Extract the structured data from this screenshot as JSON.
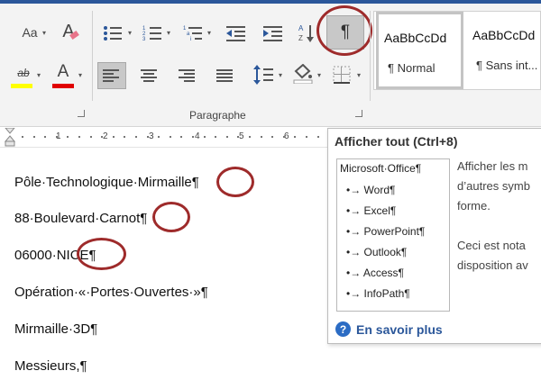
{
  "ribbon": {
    "font_size_icon": "Aa",
    "clear_format_icon": "A",
    "highlight_icon": "ab",
    "font_color_icon": "A",
    "show_all_symbol": "¶",
    "paragraph_group_label": "Paragraphe",
    "highlight_color": "#ffff00",
    "font_color": "#e00000",
    "styles": [
      {
        "sample": "AaBbCcDd",
        "name": "¶ Normal"
      },
      {
        "sample": "AaBbCcDd",
        "name": "¶ Sans int..."
      }
    ]
  },
  "ruler": {
    "numbers": [
      "1",
      "2",
      "3",
      "4",
      "5",
      "6"
    ]
  },
  "document": {
    "lines": [
      "Pôle·Technologique·Mirmaille¶",
      "88·Boulevard·Carnot¶",
      "06000·NICE¶",
      "Opération·«·Portes·Ouvertes·»¶",
      "Mirmaille·3D¶",
      "Messieurs,¶"
    ]
  },
  "tooltip": {
    "title": "Afficher tout (Ctrl+8)",
    "image_root": "Microsoft·Office¶",
    "image_items": [
      "Word¶",
      "Excel¶",
      "PowerPoint¶",
      "Outlook¶",
      "Access¶",
      "InfoPath¶"
    ],
    "bullet": "•→",
    "description_lines": [
      "Afficher les m",
      "d’autres symb",
      "forme.",
      "",
      "Ceci est nota",
      "disposition av"
    ],
    "help_icon": "?",
    "link": "En savoir plus"
  },
  "colors": {
    "accent": "#2b579a",
    "annotation_ring": "#9e2b2b"
  }
}
